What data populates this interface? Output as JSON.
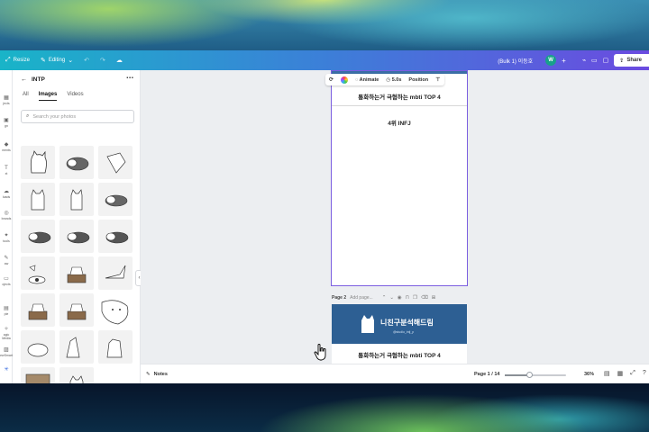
{
  "topbar": {
    "resize": "Resize",
    "editing": "Editing",
    "doc_title": "(Bulk 1) 이등호",
    "avatar_initial": "W",
    "share_label": "Share"
  },
  "rail": {
    "items": [
      "jects",
      "gn",
      "ments",
      "xt",
      "loads",
      "brands",
      "tools",
      "aw",
      "ojects",
      "ple",
      "ojects",
      "ps",
      "agic Media",
      "ewSmart",
      "ps"
    ]
  },
  "panel": {
    "title": "INTP",
    "tabs": [
      "All",
      "Images",
      "Videos"
    ],
    "active_tab": "Images",
    "search_placeholder": "Search your photos"
  },
  "toolbar": {
    "animate": "Animate",
    "duration": "5.0s",
    "position": "Position"
  },
  "page1": {
    "title": "통화하는거 극혐하는 mbti TOP 4",
    "rank": "4위 INFJ"
  },
  "page2": {
    "label": "Page 2",
    "add_title": "Add page...",
    "banner": "니친구분석해드림",
    "banner_sub": "@studio_intj_p",
    "title": "통화하는거 극혐하는 mbti TOP 4"
  },
  "bottombar": {
    "notes": "Notes",
    "pages": "Page 1 / 14",
    "zoom": "36%",
    "zoom_fraction": 0.36
  },
  "colors": {
    "accent": "#7b5ee0",
    "banner": "#2d5f93"
  }
}
